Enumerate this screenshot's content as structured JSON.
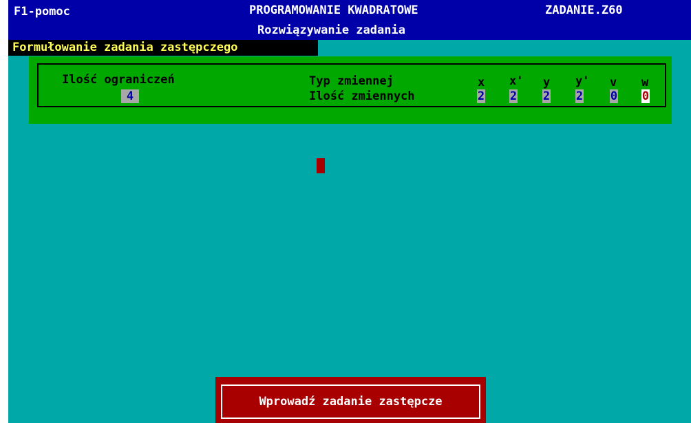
{
  "header": {
    "help": "F1-pomoc",
    "title": "PROGRAMOWANIE KWADRATOWE",
    "file": "ZADANIE.Z60",
    "subtitle": "Rozwiązywanie zadania"
  },
  "section_title": "Formułowanie zadania zastępczego",
  "constraints": {
    "label": "Ilość ograniczeń",
    "value": "4"
  },
  "variables": {
    "type_label": "Typ zmiennej",
    "count_label": "Ilość zmiennych",
    "columns": [
      {
        "name": "x",
        "value": "2"
      },
      {
        "name": "x'",
        "value": "2"
      },
      {
        "name": "y",
        "value": "2"
      },
      {
        "name": "y'",
        "value": "2"
      },
      {
        "name": "v",
        "value": "0"
      },
      {
        "name": "w",
        "value": "0"
      }
    ]
  },
  "action_button": {
    "label": "Wprowadź zadanie zastępcze"
  },
  "colors": {
    "background": "#00a8a8",
    "header": "#0000a8",
    "panel": "#00a800",
    "accent": "#a80000",
    "section_text": "#ffff55",
    "field": "#a8a8a8"
  }
}
